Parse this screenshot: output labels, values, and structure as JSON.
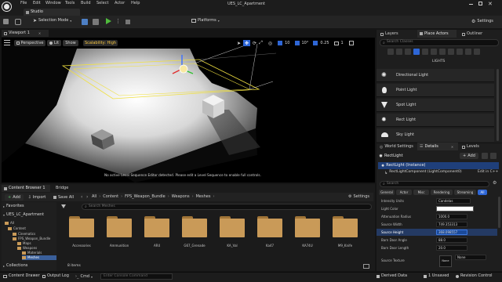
{
  "app": {
    "title": "UES_LC_Apartment",
    "project_tab": "Studio"
  },
  "menu": [
    "File",
    "Edit",
    "Window",
    "Tools",
    "Build",
    "Select",
    "Actor",
    "Help"
  ],
  "toolbar": {
    "selection_mode": "Selection Mode",
    "platforms": "Platforms",
    "settings": "Settings"
  },
  "viewport": {
    "tab": "Viewport 1",
    "perspective": "Perspective",
    "lit": "Lit",
    "show": "Show",
    "scalability": "Scalability: High",
    "grid_snap": "10",
    "rot_snap": "10°",
    "scale_snap": "0.25",
    "cam_speed": "1",
    "message": "No active Level Sequence Editor detected. Please edit a Level Sequence to enable full controls."
  },
  "place_actors": {
    "tabs": [
      "Layers",
      "Place Actors",
      "Outliner"
    ],
    "search_placeholder": "Search Classes",
    "category": "LIGHTS",
    "items": [
      "Directional Light",
      "Point Light",
      "Spot Light",
      "Rect Light",
      "Sky Light"
    ]
  },
  "details": {
    "tabs": [
      "World Settings",
      "Details",
      "Levels"
    ],
    "actor_name": "RectLight",
    "add": "Add",
    "instance": "RectLight (Instance)",
    "component": "RectLightComponent (LightComponent0)",
    "edit_cpp": "Edit in C++",
    "search_placeholder": "Search",
    "filters": [
      "General",
      "Actor",
      "Misc",
      "Rendering",
      "Streaming",
      "All"
    ],
    "properties": [
      {
        "label": "Intensity Units",
        "value": "Candelas"
      },
      {
        "label": "Light Color",
        "value": ""
      },
      {
        "label": "Attenuation Radius",
        "value": "1000.0"
      },
      {
        "label": "Source Width",
        "value": "749.353313"
      },
      {
        "label": "Source Height",
        "value": "368.098557"
      },
      {
        "label": "Barn Door Angle",
        "value": "88.0"
      },
      {
        "label": "Barn Door Length",
        "value": "20.0"
      },
      {
        "label": "Source Texture",
        "value": "None"
      }
    ],
    "texture_thumb": "None"
  },
  "content_browser": {
    "tabs": [
      "Content Browser 1",
      "Bridge"
    ],
    "add": "Add",
    "import": "Import",
    "save_all": "Save All",
    "settings": "Settings",
    "path": [
      "All",
      "Content",
      "FPS_Weapon_Bundle",
      "Weapons",
      "Meshes"
    ],
    "search_placeholder": "Search Meshes",
    "favorites": "Favorites",
    "project": "UES_LC_Apartment",
    "tree": [
      "All",
      "Content",
      "Cinematics",
      "FPS_Weapon_Bundle",
      "Maps",
      "Weapons",
      "Materials",
      "Meshes"
    ],
    "collections": "Collections",
    "items": [
      "Accessories",
      "Ammunition",
      "AR4",
      "G67_Grenade",
      "KA_Val",
      "Ka47",
      "KA74U",
      "M9_Knife"
    ],
    "count": "8 items"
  },
  "statusbar": {
    "content_drawer": "Content Drawer",
    "output_log": "Output Log",
    "cmd": "Cmd",
    "cmd_placeholder": "Enter Console Command",
    "derived_data": "Derived Data",
    "unsaved": "1 Unsaved",
    "revision": "Revision Control"
  }
}
